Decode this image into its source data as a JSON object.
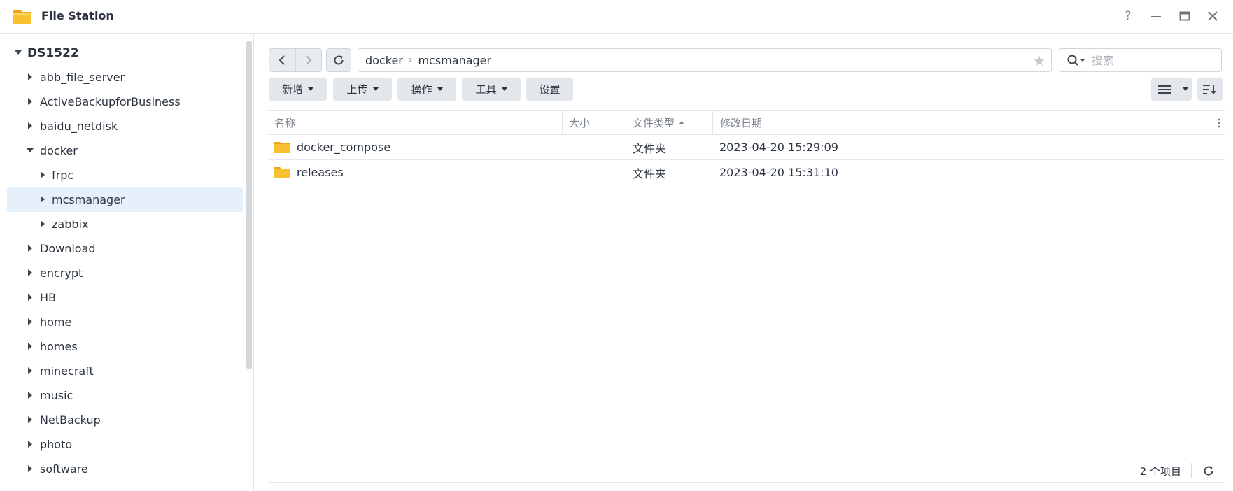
{
  "window": {
    "title": "File Station",
    "help_icon": "question-mark",
    "minimize_icon": "minimize",
    "maximize_icon": "maximize",
    "close_icon": "close"
  },
  "sidebar": {
    "root": "DS1522",
    "items": [
      {
        "label": "abb_file_server",
        "level": 1,
        "expanded": false
      },
      {
        "label": "ActiveBackupforBusiness",
        "level": 1,
        "expanded": false
      },
      {
        "label": "baidu_netdisk",
        "level": 1,
        "expanded": false
      },
      {
        "label": "docker",
        "level": 1,
        "expanded": true
      },
      {
        "label": "frpc",
        "level": 2,
        "expanded": false
      },
      {
        "label": "mcsmanager",
        "level": 2,
        "expanded": false,
        "selected": true
      },
      {
        "label": "zabbix",
        "level": 2,
        "expanded": false
      },
      {
        "label": "Download",
        "level": 1,
        "expanded": false
      },
      {
        "label": "encrypt",
        "level": 1,
        "expanded": false
      },
      {
        "label": "HB",
        "level": 1,
        "expanded": false
      },
      {
        "label": "home",
        "level": 1,
        "expanded": false
      },
      {
        "label": "homes",
        "level": 1,
        "expanded": false
      },
      {
        "label": "minecraft",
        "level": 1,
        "expanded": false
      },
      {
        "label": "music",
        "level": 1,
        "expanded": false
      },
      {
        "label": "NetBackup",
        "level": 1,
        "expanded": false
      },
      {
        "label": "photo",
        "level": 1,
        "expanded": false
      },
      {
        "label": "software",
        "level": 1,
        "expanded": false
      }
    ]
  },
  "toolbar": {
    "path": [
      "docker",
      "mcsmanager"
    ],
    "search_placeholder": "搜索",
    "buttons": {
      "create": "新增",
      "upload": "上传",
      "action": "操作",
      "tools": "工具",
      "settings": "设置"
    }
  },
  "list": {
    "columns": {
      "name": "名称",
      "size": "大小",
      "type": "文件类型",
      "modified": "修改日期"
    },
    "rows": [
      {
        "name": "docker_compose",
        "size": "",
        "type": "文件夹",
        "modified": "2023-04-20 15:29:09"
      },
      {
        "name": "releases",
        "size": "",
        "type": "文件夹",
        "modified": "2023-04-20 15:31:10"
      }
    ]
  },
  "status": {
    "count": "2 个项目"
  },
  "colors": {
    "accent_selected": "#e6f0fb",
    "folder": "#f5b82e",
    "button_bg": "#e3e6ea"
  }
}
